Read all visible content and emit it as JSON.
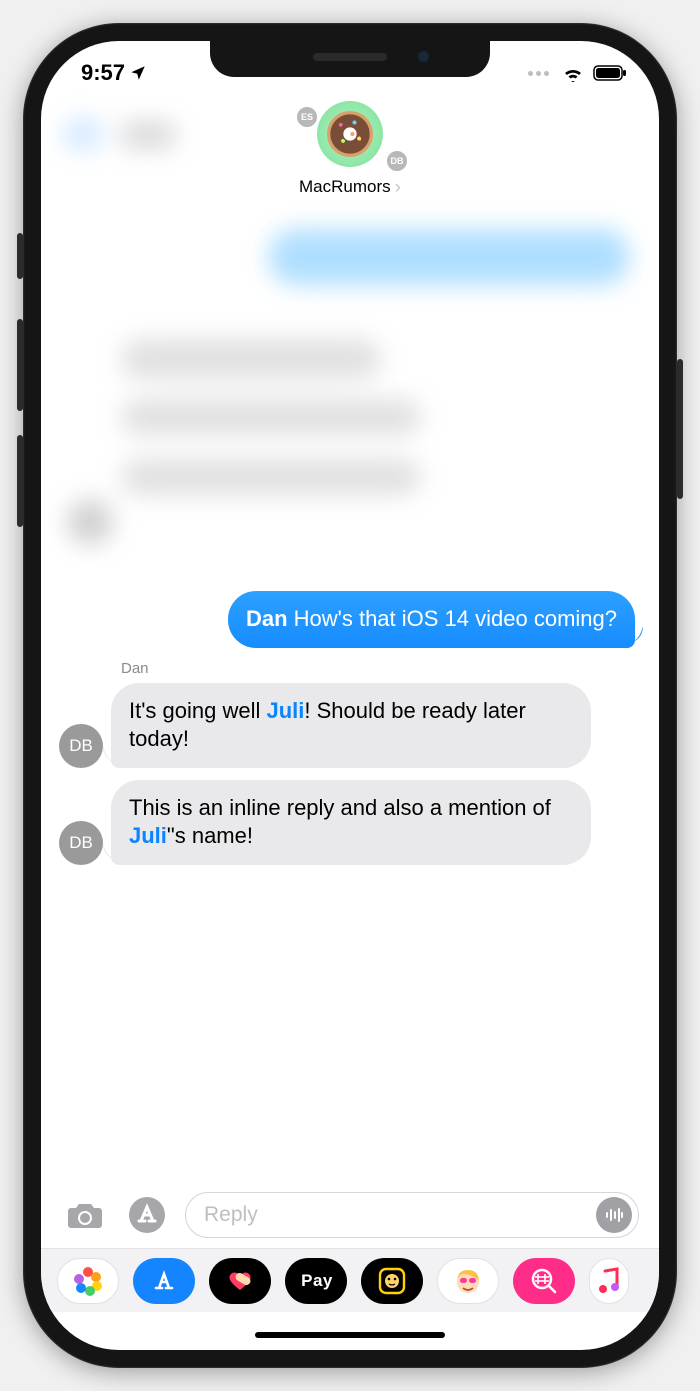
{
  "status": {
    "time": "9:57",
    "location_arrow": "↗"
  },
  "header": {
    "group_name": "MacRumors",
    "small_avatars": {
      "es": "ES",
      "db": "DB"
    }
  },
  "messages": {
    "m1": {
      "mention": "Dan",
      "rest": " How's that iOS 14 video coming?"
    },
    "m2": {
      "sender": "Dan",
      "avatar": "DB",
      "pre": "It's going well ",
      "mention": "Juli",
      "post": "! Should be ready later today!"
    },
    "m3": {
      "avatar": "DB",
      "pre": "This is an inline reply and also a mention of ",
      "mention": "Juli",
      "post": "\"s name!"
    }
  },
  "input": {
    "placeholder": "Reply"
  },
  "apps": {
    "pay_label": "Pay"
  }
}
